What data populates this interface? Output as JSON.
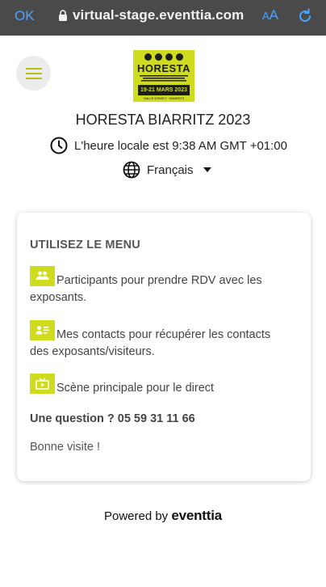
{
  "browser": {
    "done_label": "OK",
    "url": "virtual-stage.eventtia.com",
    "text_size_small": "A",
    "text_size_large": "A"
  },
  "header": {
    "logo": {
      "word": "HORESTA",
      "date": "19-21 MARS 2023",
      "place": "HALLE D'IRATY · BIARRITZ"
    },
    "event_title": "HORESTA BIARRITZ 2023",
    "local_time": "L'heure locale est 9:38 AM GMT +01:00",
    "language": "Français"
  },
  "card": {
    "heading": "UTILISEZ LE MENU",
    "items": [
      {
        "icon": "participants-icon",
        "text": "Participants pour prendre RDV avec les exposants."
      },
      {
        "icon": "contacts-icon",
        "text": "Mes contacts pour récupérer les contacts des exposants/visiteurs."
      },
      {
        "icon": "stage-icon",
        "text": "Scène principale pour le direct"
      }
    ],
    "question": "Une question ? 05 59 31 11 66",
    "goodbye": "Bonne visite !"
  },
  "footer": {
    "powered_by": "Powered by",
    "brand": "eventtia"
  },
  "colors": {
    "accent": "#cfdc1e",
    "browser_bar": "#4a4a4a",
    "browser_link": "#4aa3ff",
    "card_text": "#444444"
  }
}
